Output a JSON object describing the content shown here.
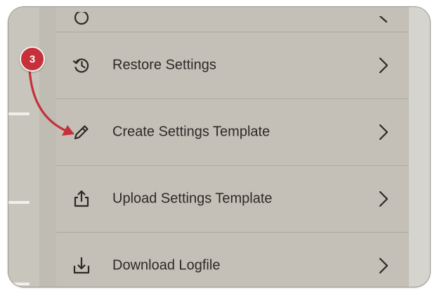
{
  "annotation": {
    "step_number": "3",
    "badge_color": "#c6303a"
  },
  "menu": {
    "items": [
      {
        "label": "Restore Settings",
        "icon": "restore-history-icon"
      },
      {
        "label": "Create Settings Template",
        "icon": "pencil-icon"
      },
      {
        "label": "Upload Settings Template",
        "icon": "upload-icon"
      },
      {
        "label": "Download Logfile",
        "icon": "download-icon"
      }
    ]
  },
  "colors": {
    "panel_bg": "#c4c0b7",
    "text": "#2b2a27",
    "divider": "#acaaa2"
  }
}
